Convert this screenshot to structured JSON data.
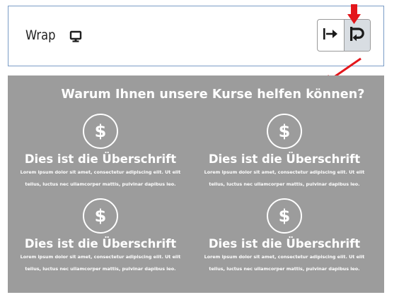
{
  "control": {
    "label": "Wrap",
    "device_icon": "desktop-monitor-icon",
    "options": [
      {
        "name": "no-wrap",
        "icon": "arrow-right-to-bar-icon",
        "active": false
      },
      {
        "name": "wrap",
        "icon": "wrap-icon",
        "active": true
      }
    ]
  },
  "annotations": {
    "arrow_color": "#e3161b"
  },
  "preview": {
    "background": "#9c9c9c",
    "title": "Warum Ihnen unsere Kurse helfen können?",
    "features": [
      {
        "icon": "dollar-icon",
        "icon_glyph": "$",
        "heading": "Dies ist die Überschrift",
        "body": "Lorem ipsum dolor sit amet, consectetur adipiscing elit. Ut elit tellus, luctus nec ullamcorper mattis, pulvinar dapibus leo."
      },
      {
        "icon": "dollar-icon",
        "icon_glyph": "$",
        "heading": "Dies ist die Überschrift",
        "body": "Lorem ipsum dolor sit amet, consectetur adipiscing elit. Ut elit tellus, luctus nec ullamcorper mattis, pulvinar dapibus leo."
      },
      {
        "icon": "dollar-icon",
        "icon_glyph": "$",
        "heading": "Dies ist die Überschrift",
        "body": "Lorem ipsum dolor sit amet, consectetur adipiscing elit. Ut elit tellus, luctus nec ullamcorper mattis, pulvinar dapibus leo."
      },
      {
        "icon": "dollar-icon",
        "icon_glyph": "$",
        "heading": "Dies ist die Überschrift",
        "body": "Lorem ipsum dolor sit amet, consectetur adipiscing elit. Ut elit tellus, luctus nec ullamcorper mattis, pulvinar dapibus leo."
      }
    ]
  }
}
